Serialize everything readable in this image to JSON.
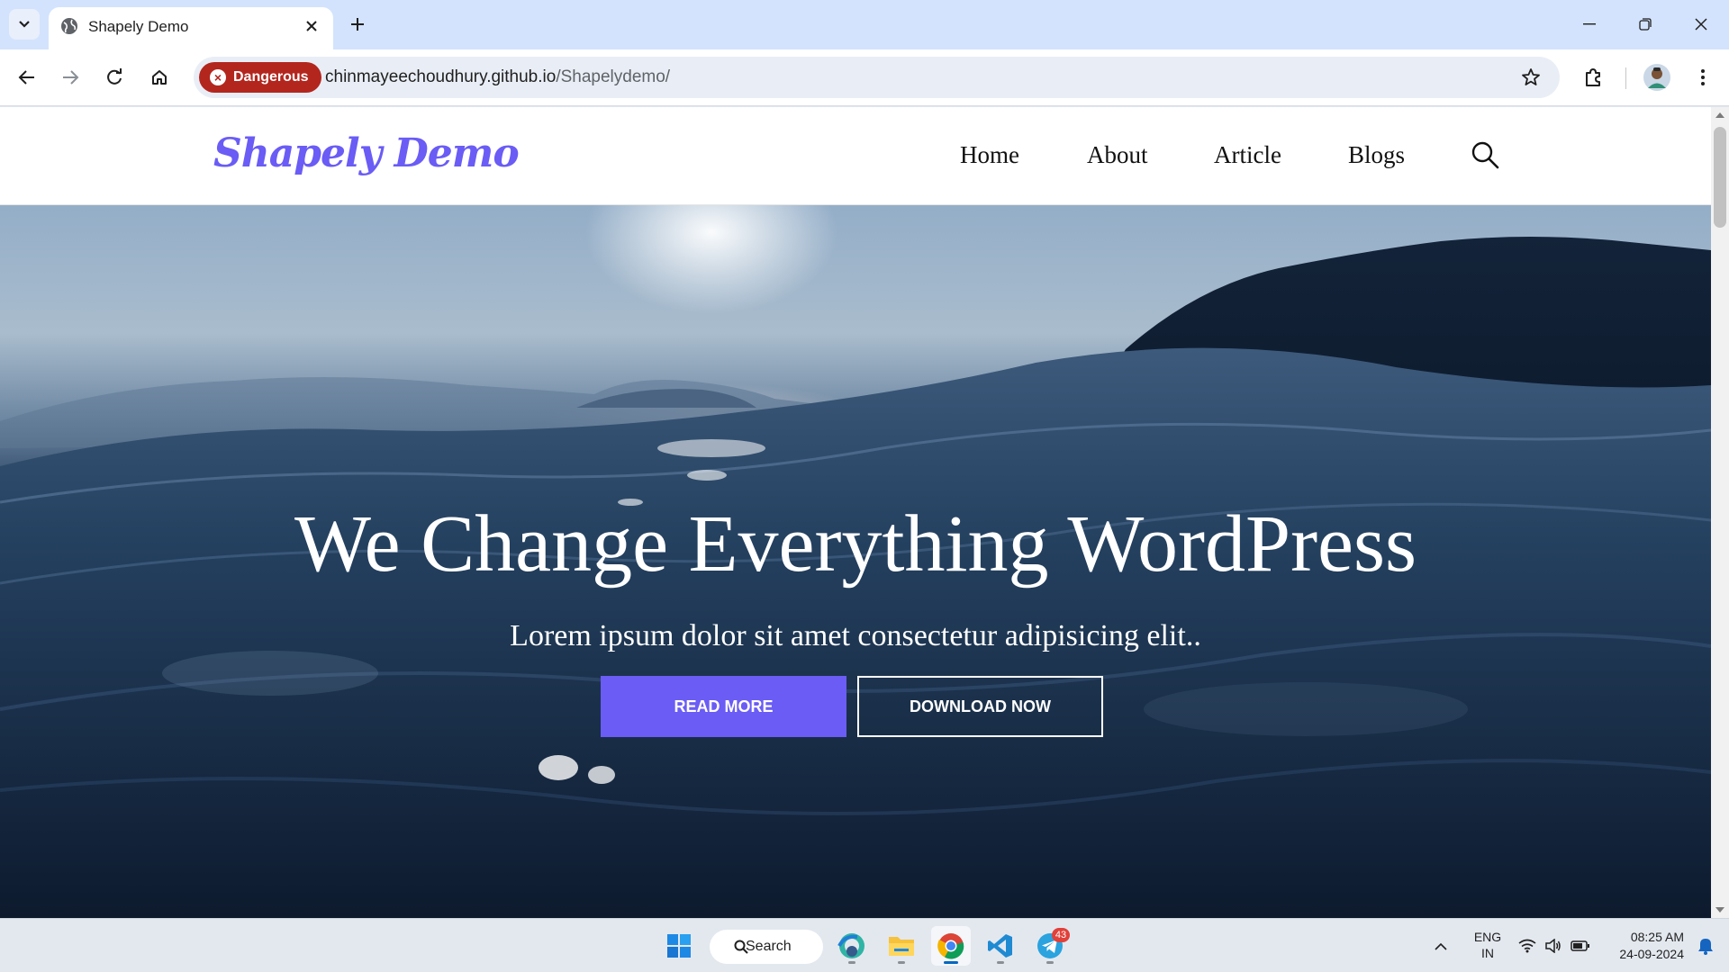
{
  "browser": {
    "tab_title": "Shapely Demo",
    "security_label": "Dangerous",
    "url_host": "chinmayeechoudhury.github.io",
    "url_path": "/Shapelydemo/"
  },
  "site": {
    "logo": "Shapely Demo",
    "nav": [
      "Home",
      "About",
      "Article",
      "Blogs"
    ],
    "hero_title": "We Change Everything WordPress",
    "hero_subtitle": "Lorem ipsum dolor sit amet consectetur adipisicing elit..",
    "btn_read_more": "READ MORE",
    "btn_download": "DOWNLOAD NOW",
    "accent_color": "#6a5cf5"
  },
  "taskbar": {
    "search_label": "Search",
    "telegram_badge": "43",
    "lang_line1": "ENG",
    "lang_line2": "IN",
    "time": "08:25 AM",
    "date": "24-09-2024"
  },
  "colors": {
    "danger": "#b3261e",
    "tabbar": "#d3e3fd",
    "omnibox": "#e9eef6"
  }
}
